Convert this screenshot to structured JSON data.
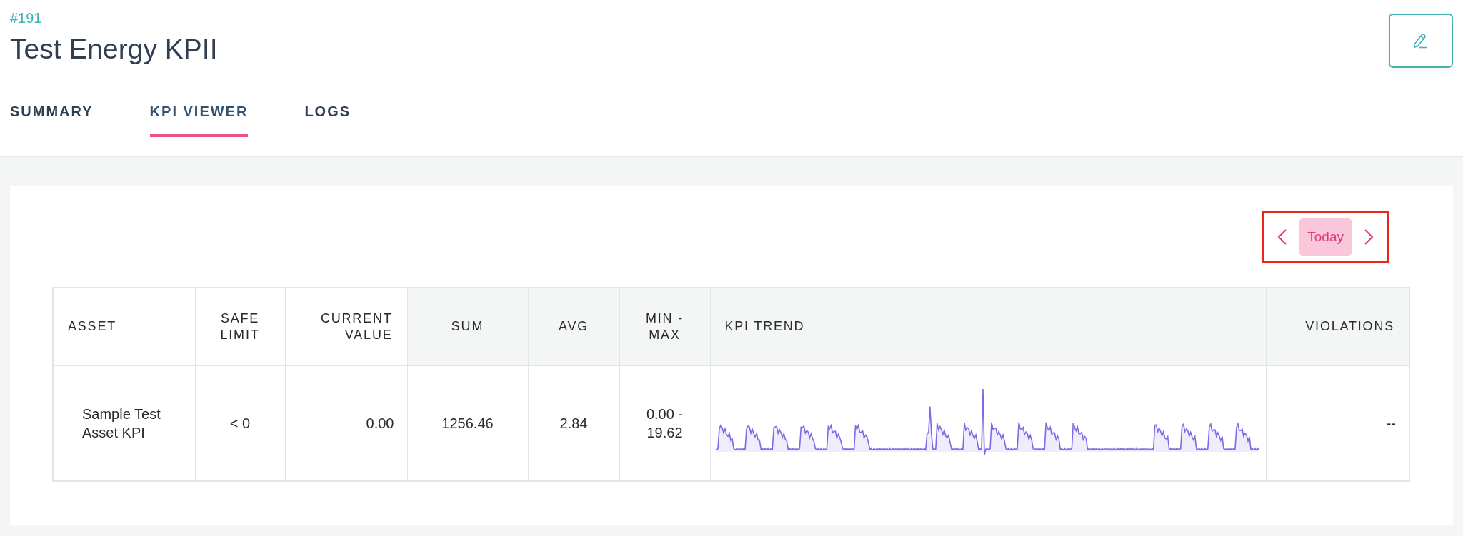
{
  "header": {
    "id_label": "#191",
    "title": "Test Energy KPII"
  },
  "tabs": [
    {
      "label": "SUMMARY",
      "selected": false
    },
    {
      "label": "KPI VIEWER",
      "selected": true
    },
    {
      "label": "LOGS",
      "selected": false
    }
  ],
  "date_nav": {
    "label": "Today"
  },
  "table": {
    "columns": [
      "ASSET",
      "SAFE LIMIT",
      "CURRENT VALUE",
      "SUM",
      "AVG",
      "MIN - MAX",
      "KPI TREND",
      "VIOLATIONS"
    ],
    "rows": [
      {
        "asset": "Sample Test Asset KPI",
        "safe_limit": "< 0",
        "current_value": "0.00",
        "sum": "1256.46",
        "avg": "2.84",
        "min_max": "0.00 - 19.62",
        "violations": "--"
      }
    ]
  }
}
